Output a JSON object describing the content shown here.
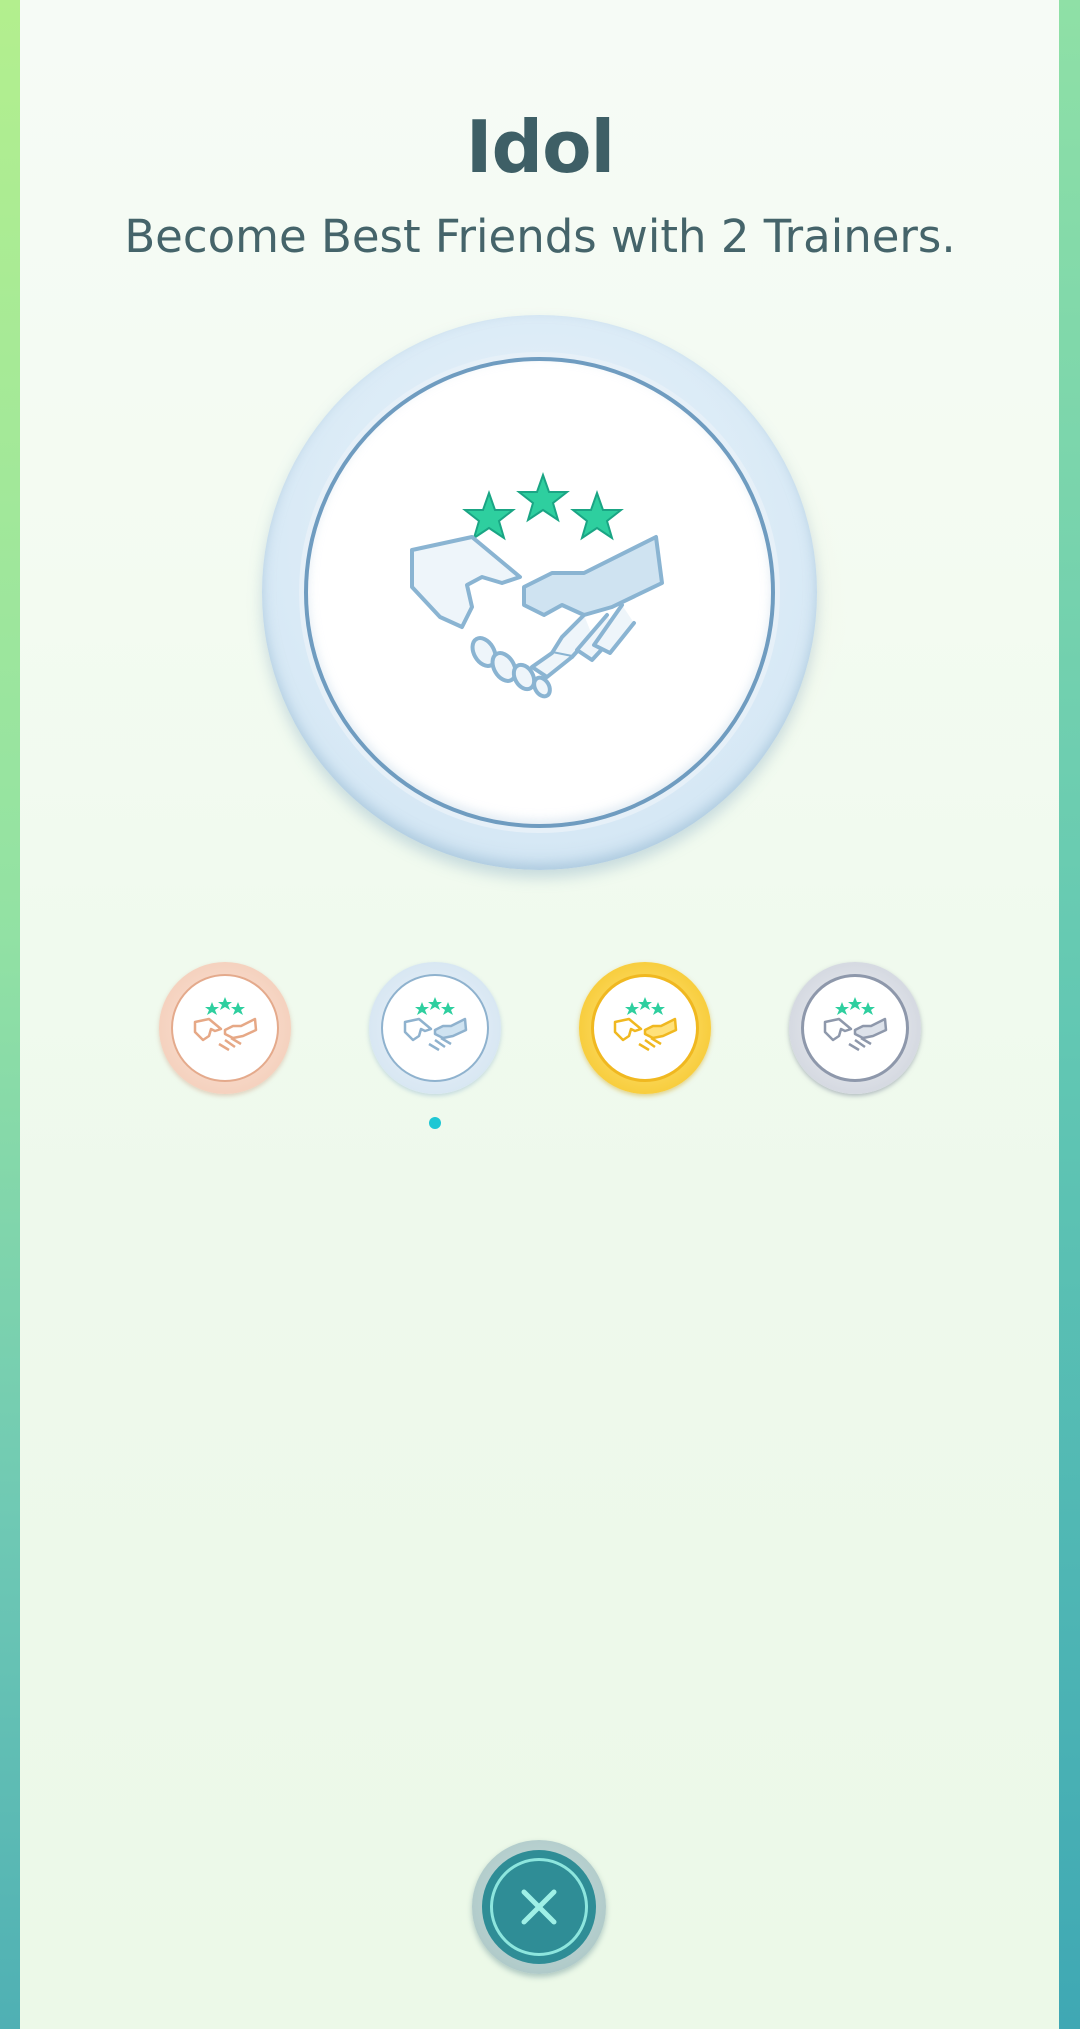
{
  "medal": {
    "title": "Idol",
    "description": "Become Best Friends with 2 Trainers.",
    "icon": "handshake-with-stars-icon",
    "current_tier": "silver",
    "tiers": [
      {
        "name": "bronze",
        "icon": "handshake-with-stars-icon"
      },
      {
        "name": "silver",
        "icon": "handshake-with-stars-icon"
      },
      {
        "name": "gold",
        "icon": "handshake-with-stars-icon"
      },
      {
        "name": "platinum",
        "icon": "handshake-with-stars-icon"
      }
    ]
  },
  "close_button": {
    "icon": "close-icon"
  },
  "colors": {
    "title_text": "#3e5f66",
    "star_green": "#2ecf9f",
    "selected_dot": "#1fc7d4",
    "close_button": "#2f8d96"
  }
}
